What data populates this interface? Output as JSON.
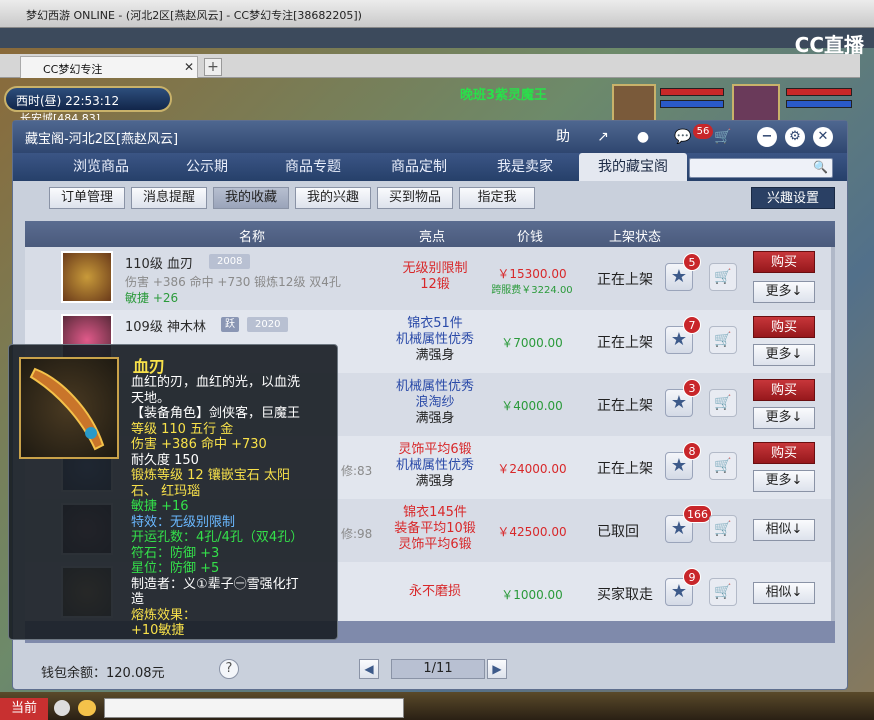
{
  "browser": {
    "title": "梦幻西游 ONLINE - (河北2区[燕赵风云] - CC梦幻专注[38682205])",
    "tab": "CC梦幻专注",
    "brand": "CC直播"
  },
  "game": {
    "clock": "西时(昼)  22:53:12",
    "place": "长安城[484,83]",
    "title": "晚班3紫灵魔王"
  },
  "dialog": {
    "title": "藏宝阁-河北2区[燕赵风云]",
    "header_icons": [
      "助",
      "share-icon",
      "record-icon",
      "chat-icon",
      "cart-icon",
      "minimize-icon",
      "settings-icon",
      "close-icon"
    ],
    "chat_badge": "56",
    "help_label": "助",
    "nav": [
      "浏览商品",
      "公示期",
      "商品专题",
      "商品定制",
      "我是卖家",
      "我的藏宝阁"
    ],
    "nav_active": 5,
    "search_placeholder": "",
    "subtabs": [
      "订单管理",
      "消息提醒",
      "我的收藏",
      "我的兴趣",
      "买到物品",
      "指定我"
    ],
    "subtab_selected": 2,
    "interest_btn": "兴趣设置",
    "columns": [
      "名称",
      "亮点",
      "价钱",
      "上架状态"
    ],
    "rows": [
      {
        "level": "110级",
        "name": "血刃",
        "tag": "2008",
        "stat1": "伤害 +386 命中 +730 锻炼12级 双4孔",
        "stat2": "敏捷 +26",
        "hl": [
          "无级别限制",
          "12锻"
        ],
        "hl_color": "#d8282a",
        "price": "￥15300.00",
        "price2": "跨服费￥3224.00",
        "status": "正在上架",
        "badge": "5",
        "btn1": "购买",
        "btn2": "更多↓"
      },
      {
        "level": "109级",
        "name": "神木林",
        "tag": "2020",
        "stat1": "",
        "stat2": "",
        "hl": [
          "锦衣51件",
          "机械属性优秀",
          "满强身"
        ],
        "hl_color": "#2a4aa8",
        "price": "￥7000.00",
        "price2": "",
        "status": "正在上架",
        "badge": "7",
        "btn1": "购买",
        "btn2": "更多↓"
      },
      {
        "level": "",
        "name": "",
        "tag": "",
        "stat1": "",
        "stat2": "",
        "hl": [
          "机械属性优秀",
          "浪淘纱",
          "满强身"
        ],
        "hl_color": "#2a4aa8",
        "price": "￥4000.00",
        "price2": "",
        "status": "正在上架",
        "badge": "3",
        "btn1": "购买",
        "btn2": "更多↓"
      },
      {
        "level": "",
        "name": "",
        "tag": "",
        "stat1": "",
        "stat2": "修:83",
        "hl": [
          "灵饰平均6锻",
          "机械属性优秀",
          "满强身"
        ],
        "hl_color": "#2a4aa8",
        "price": "￥24000.00",
        "price2": "",
        "status": "正在上架",
        "badge": "8",
        "btn1": "购买",
        "btn2": "更多↓"
      },
      {
        "level": "",
        "name": "",
        "tag": "",
        "stat1": "",
        "stat2": "修:98",
        "hl": [
          "锦衣145件",
          "装备平均10锻",
          "灵饰平均6锻"
        ],
        "hl_color": "#d8282a",
        "price": "￥42500.00",
        "price2": "",
        "status": "已取回",
        "badge": "166",
        "btn1": "",
        "btn2": "相似↓"
      },
      {
        "level": "",
        "name": "",
        "tag": "",
        "stat1": "",
        "stat2": "",
        "hl": [
          "永不磨损"
        ],
        "hl_color": "#d8282a",
        "price": "￥1000.00",
        "price2": "",
        "status": "买家取走",
        "badge": "9",
        "btn1": "",
        "btn2": "相似↓"
      }
    ],
    "wallet": "钱包余额：120.08元",
    "page": "1/11"
  },
  "tooltip": {
    "name": "血刃",
    "lines": [
      {
        "t": "血红的刃，血红的光，以血洗",
        "c": "#ffffff"
      },
      {
        "t": "天地。",
        "c": "#ffffff"
      },
      {
        "t": "【装备角色】剑侠客，巨魔王",
        "c": "#ffffff"
      },
      {
        "t": "等级 110  五行 金",
        "c": "#f8e14a"
      },
      {
        "t": "伤害 +386 命中 +730",
        "c": "#f8e14a"
      },
      {
        "t": "耐久度 150",
        "c": "#ffffff"
      },
      {
        "t": "锻炼等级 12   镶嵌宝石 太阳",
        "c": "#f8e14a"
      },
      {
        "t": "石、 红玛瑙",
        "c": "#f8e14a"
      },
      {
        "t": "敏捷 +16",
        "c": "#34e04a"
      },
      {
        "t": "特效：无级别限制",
        "c": "#6ab8ff"
      },
      {
        "t": "开运孔数：4孔/4孔（双4孔）",
        "c": "#34e04a"
      },
      {
        "t": "符石：防御 +3",
        "c": "#34e04a"
      },
      {
        "t": "星位：防御 +5",
        "c": "#34e04a"
      },
      {
        "t": "制造者：义①辈子㊀雪强化打",
        "c": "#ffffff"
      },
      {
        "t": "造",
        "c": "#ffffff"
      },
      {
        "t": "熔炼效果：",
        "c": "#f8e14a"
      },
      {
        "t": "+10敏捷",
        "c": "#f8e14a"
      }
    ]
  },
  "bottom": {
    "current": "当前"
  }
}
